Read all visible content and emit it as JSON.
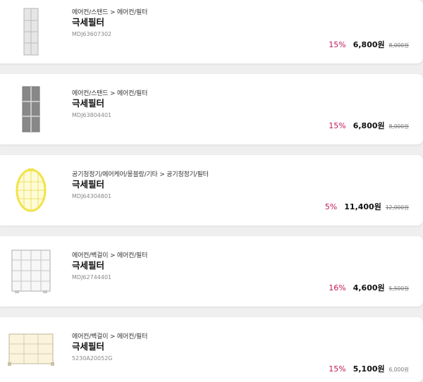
{
  "products": [
    {
      "category": "에어컨/스탠드 > 에어컨/필터",
      "name": "극세필터",
      "code": "MDJ63607302",
      "discount_rate": "15%",
      "price": "6,800원",
      "original_price": "8,000원",
      "image_icon": "tall-white-filter-icon"
    },
    {
      "category": "에어컨/스탠드 > 에어컨/필터",
      "name": "극세필터",
      "code": "MDJ63804401",
      "discount_rate": "15%",
      "price": "6,800원",
      "original_price": "8,000원",
      "image_icon": "tall-gray-filter-icon"
    },
    {
      "category": "공기청정기/에어케어/몽블랑/기타 > 공기청정기/필터",
      "name": "극세필터",
      "code": "MDJ64304801",
      "discount_rate": "5%",
      "price": "11,400원",
      "original_price": "12,000원",
      "image_icon": "oval-yellow-filter-icon"
    },
    {
      "category": "에어컨/벽걸이 > 에어컨/필터",
      "name": "극세필터",
      "code": "MDJ62744401",
      "discount_rate": "16%",
      "price": "4,600원",
      "original_price": "5,500원",
      "image_icon": "square-grid-filter-icon"
    },
    {
      "category": "에어컨/벽걸이 > 에어컨/필터",
      "name": "극세필터",
      "code": "5230A20052G",
      "discount_rate": "15%",
      "price": "5,100원",
      "original_price": "6,000원",
      "image_icon": "wide-cream-filter-icon"
    }
  ],
  "colors": {
    "discount": "#c2185b",
    "background": "#efefef",
    "card": "#ffffff"
  }
}
